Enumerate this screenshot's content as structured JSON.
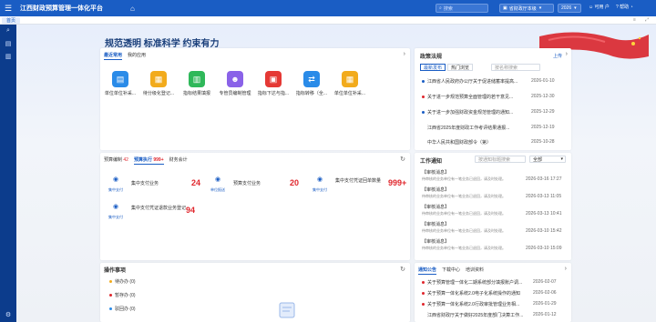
{
  "app": {
    "title": "江西财政预算管理一体化平台"
  },
  "topbar": {
    "search_placeholder": "搜索",
    "dept": "省财政厅本级",
    "year": "2026",
    "user": "可用 户",
    "help": "帮助"
  },
  "tabs": {
    "home": "首页"
  },
  "slogan": "规范透明 标准科学 约束有力",
  "apps": {
    "tabs": [
      "最近常用",
      "我的应用"
    ],
    "items": [
      {
        "label": "单位单位补采..."
      },
      {
        "label": "待分级化登记..."
      },
      {
        "label": "指标结果填报"
      },
      {
        "label": "专管员编制管理"
      },
      {
        "label": "指标下达与指..."
      },
      {
        "label": "指标转移（全..."
      },
      {
        "label": "单位单位补采..."
      }
    ]
  },
  "budget": {
    "tabs": [
      {
        "label": "预算编制",
        "badge": "42"
      },
      {
        "label": "预算执行",
        "badge": "999+"
      },
      {
        "label": "财务会计",
        "badge": ""
      }
    ],
    "stats": [
      {
        "sub": "集中支付",
        "label": "集中支付业务",
        "value": "24"
      },
      {
        "sub": "单位报送",
        "label": "预算支付业务",
        "value": "20"
      },
      {
        "sub": "集中支付",
        "label": "集中支付凭证回单数量",
        "value": "999+"
      },
      {
        "sub": "集中支付",
        "label": "集中支付凭证退款业务登记",
        "value": "94"
      }
    ]
  },
  "policy": {
    "title": "政策法规",
    "more": "上传",
    "filters": [
      "最新发布",
      "热门浏览"
    ],
    "search_placeholder": "按名称搜索",
    "items": [
      {
        "text": "江西省人民政府办公厅关于促进储蓄率提高...",
        "date": "2026-01-10",
        "color": "#1a5dc4"
      },
      {
        "text": "关于进一步规范预算全面管理的若干意见...",
        "date": "2025-12-30",
        "color": "#e0262c"
      },
      {
        "text": "关于进一步加强财政资金规范管理的通知...",
        "date": "2025-12-29",
        "color": "#1a5dc4"
      },
      {
        "text": "江西省2025年度财政工作考评结果通报...",
        "date": "2025-12-19",
        "color": ""
      },
      {
        "text": "中华人民共和国财政部令（第）",
        "date": "2025-10-28",
        "color": ""
      }
    ]
  },
  "work": {
    "title": "工作通知",
    "search_placeholder": "按通知标题搜索",
    "select": "全部",
    "items": [
      {
        "title": "【审核消息】",
        "sub": "待审核的业务单位有一笔业务已退回，请及时处理。",
        "time": "2026-03-16 17:27"
      },
      {
        "title": "【审核消息】",
        "sub": "待审核的业务单位有一笔业务已退回，请及时处理。",
        "time": "2026-03-13 11:05"
      },
      {
        "title": "【审核消息】",
        "sub": "待审核的业务单位有一笔业务已退回，请及时处理。",
        "time": "2026-03-13 10:41"
      },
      {
        "title": "【审核消息】",
        "sub": "待审核的业务单位有一笔业务已退回，请及时处理。",
        "time": "2026-03-10 15:42"
      },
      {
        "title": "【审核消息】",
        "sub": "待审核的业务单位有一笔业务已退回，请及时处理。",
        "time": "2026-03-10 15:09"
      }
    ]
  },
  "todo": {
    "title": "操作事项",
    "items": [
      {
        "label": "待办办",
        "count": "(0)"
      },
      {
        "label": "暂存办",
        "count": "(0)"
      },
      {
        "label": "驳回办",
        "count": "(0)"
      }
    ]
  },
  "notice": {
    "tabs": [
      "通知公告",
      "下载中心",
      "培训资料"
    ],
    "items": [
      {
        "text": "关于预算管理一体化二期系统部分填报账户调...",
        "date": "2026-02-07"
      },
      {
        "text": "关于预算一体化系统2.0电子化系统操作的通知",
        "date": "2026-02-06"
      },
      {
        "text": "关于预算一体化系统2.0行政审批管理业务相...",
        "date": "2026-01-29"
      },
      {
        "text": "江西省财政厅关于做好2025年度部门决算工作...",
        "date": "2026-01-12"
      }
    ]
  }
}
